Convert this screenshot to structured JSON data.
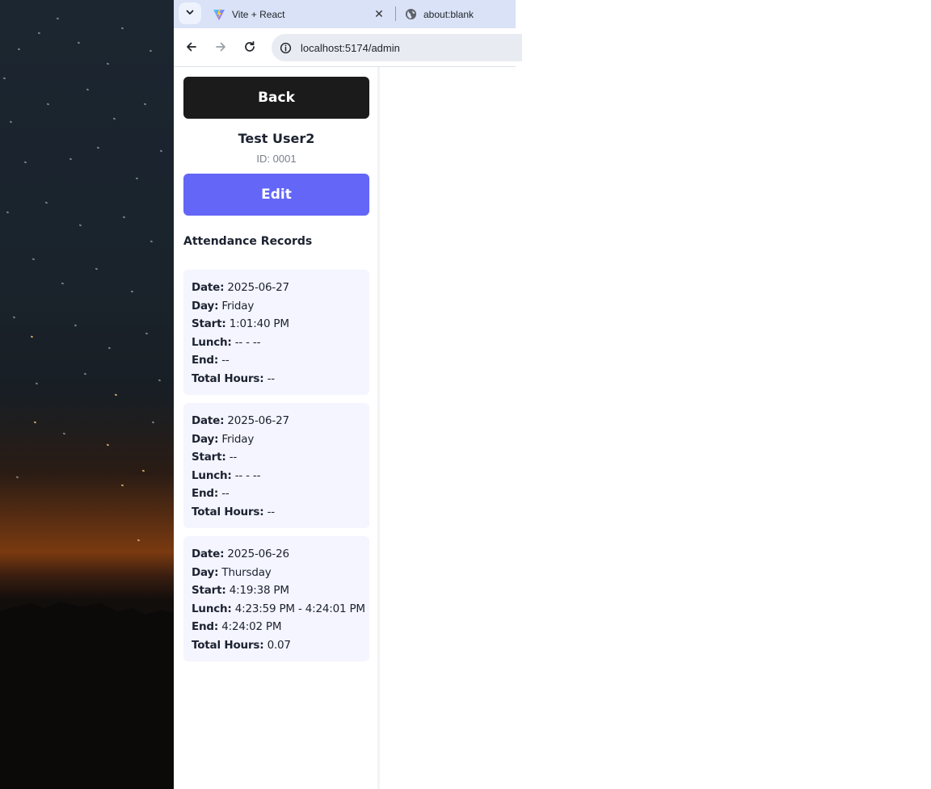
{
  "browser": {
    "tabs": [
      {
        "title": "Vite + React",
        "icon": "vite-logo-icon",
        "active": true
      },
      {
        "title": "about:blank",
        "icon": "globe-icon",
        "active": false
      }
    ],
    "url": "localhost:5174/admin"
  },
  "page": {
    "back_label": "Back",
    "user_name": "Test User2",
    "user_id": "ID: 0001",
    "edit_label": "Edit",
    "section_title": "Attendance Records",
    "labels": {
      "date": "Date:",
      "day": "Day:",
      "start": "Start:",
      "lunch": "Lunch:",
      "end": "End:",
      "total": "Total Hours:"
    },
    "records": [
      {
        "date": "2025-06-27",
        "day": "Friday",
        "start": "1:01:40 PM",
        "lunch": "-- - --",
        "end": "--",
        "total": "--"
      },
      {
        "date": "2025-06-27",
        "day": "Friday",
        "start": "--",
        "lunch": "-- - --",
        "end": "--",
        "total": "--"
      },
      {
        "date": "2025-06-26",
        "day": "Thursday",
        "start": "4:19:38 PM",
        "lunch": "4:23:59 PM - 4:24:01 PM",
        "end": "4:24:02 PM",
        "total": "0.07"
      }
    ]
  },
  "colors": {
    "back_button": "#1b1b1b",
    "edit_button": "#6366f6",
    "record_card": "#f4f5fe",
    "tabstrip": "#d9e2f6"
  }
}
